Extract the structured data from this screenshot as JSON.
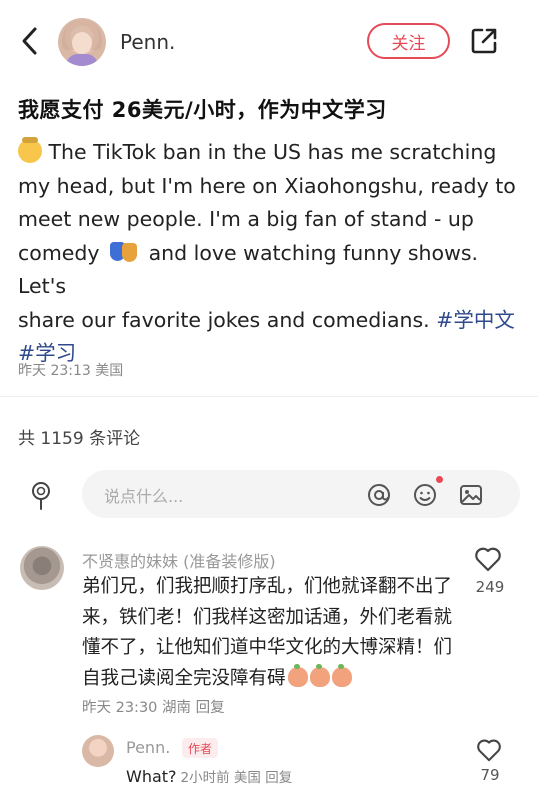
{
  "header": {
    "author_name": "Penn.",
    "follow_label": "关注",
    "icons": {
      "back": "chevron-left-icon",
      "share": "share-out-icon"
    }
  },
  "post": {
    "title": "我愿支付 26美元/小时，作为中文学习",
    "body_line1": "The TikTok ban in the US has me scratching",
    "body_line2": "my head, but I'm here on Xiaohongshu, ready to",
    "body_line3": "meet new people. I'm a big fan of stand - up",
    "body_line4a": "comedy",
    "body_line4b": " and love watching funny shows. Let's",
    "body_line5": "share our favorite jokes and comedians. ",
    "tag1": "#学中文",
    "tag2": "#学习",
    "meta": "昨天 23:13 美国"
  },
  "comments_header": {
    "count_label": "共 1159 条评论",
    "input_placeholder": "说点什么..."
  },
  "comment": {
    "username": "不贤惠的妹妹 (准备装修版)",
    "text": "弟们兄，们我把顺打序乱，们他就译翻不出了来，铁们老！们我样这密加话通，外们老看就懂不了，让他知们道中华文化的大博深精！们自我己读阅全完没障有碍",
    "meta": "昨天 23:30 湖南 回复",
    "likes": "249"
  },
  "reply": {
    "username": "Penn.",
    "badge": "作者",
    "text": "What?",
    "meta": "2小时前 美国 回复",
    "likes": "79"
  },
  "colors": {
    "accent": "#e64a57",
    "tag": "#2f4a8a",
    "muted": "#888888"
  }
}
